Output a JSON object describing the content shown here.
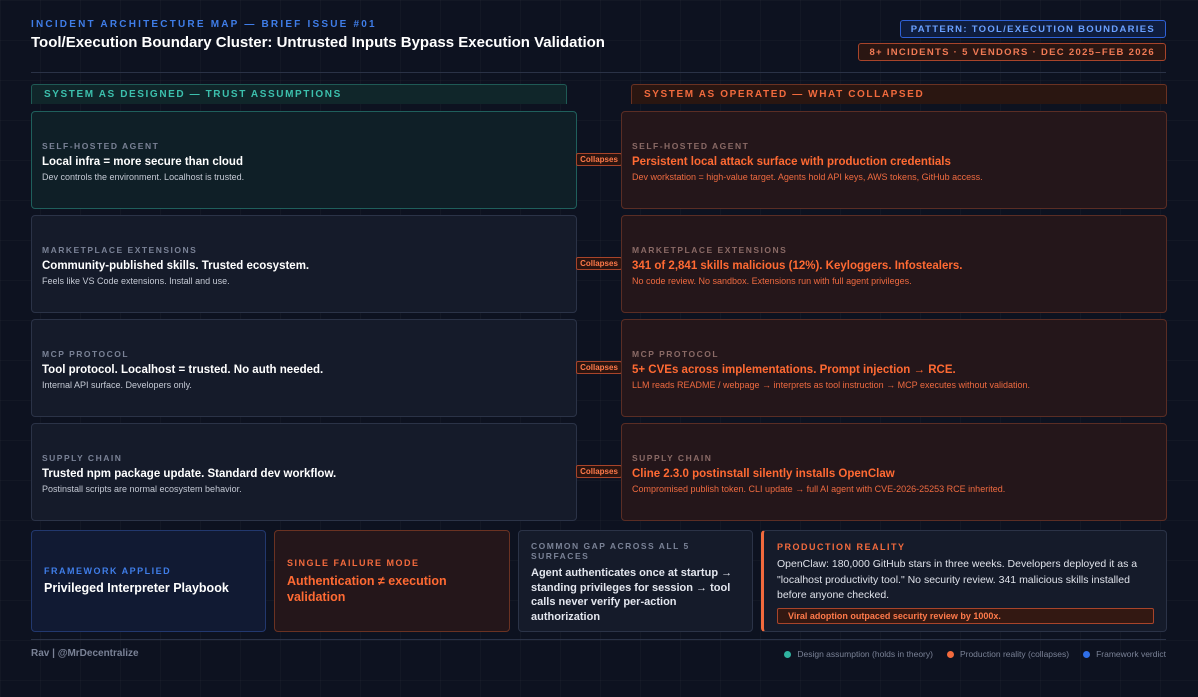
{
  "header": {
    "kicker": "INCIDENT ARCHITECTURE MAP — BRIEF ISSUE #01",
    "title": "Tool/Execution Boundary Cluster: Untrusted Inputs Bypass Execution Validation",
    "pattern_tag": "PATTERN: TOOL/EXECUTION BOUNDARIES",
    "incidents_tag": "8+ INCIDENTS · 5 VENDORS · DEC 2025–FEB 2026"
  },
  "columns": {
    "designed": "SYSTEM AS DESIGNED — TRUST ASSUMPTIONS",
    "operated": "SYSTEM AS OPERATED — WHAT COLLAPSED"
  },
  "collapse_label": "Collapses",
  "rows": [
    {
      "label": "SELF-HOSTED AGENT",
      "designed_main": "Local infra = more secure than cloud",
      "designed_sub": "Dev controls the environment. Localhost is trusted.",
      "operated_main": "Persistent local attack surface with production credentials",
      "operated_sub": "Dev workstation = high-value target. Agents hold API keys, AWS tokens, GitHub access."
    },
    {
      "label": "MARKETPLACE EXTENSIONS",
      "designed_main": "Community-published skills. Trusted ecosystem.",
      "designed_sub": "Feels like VS Code extensions. Install and use.",
      "operated_main": "341 of 2,841 skills malicious (12%). Keyloggers. Infostealers.",
      "operated_sub": "No code review. No sandbox. Extensions run with full agent privileges."
    },
    {
      "label": "MCP PROTOCOL",
      "designed_main": "Tool protocol. Localhost = trusted. No auth needed.",
      "designed_sub": "Internal API surface. Developers only.",
      "operated_main": "5+ CVEs across implementations. Prompt injection → RCE.",
      "operated_sub": "LLM reads README / webpage → interprets as tool instruction → MCP executes without validation."
    },
    {
      "label": "SUPPLY CHAIN",
      "designed_main": "Trusted npm package update. Standard dev workflow.",
      "designed_sub": "Postinstall scripts are normal ecosystem behavior.",
      "operated_main": "Cline 2.3.0 postinstall silently installs OpenClaw",
      "operated_sub": "Compromised publish token. CLI update → full AI agent with CVE-2026-25253 RCE inherited."
    }
  ],
  "bottom": {
    "framework": {
      "label": "FRAMEWORK APPLIED",
      "main": "Privileged Interpreter Playbook"
    },
    "failure": {
      "label": "SINGLE FAILURE MODE",
      "main": "Authentication ≠ execution validation"
    },
    "gap": {
      "label": "COMMON GAP ACROSS ALL 5 SURFACES",
      "main": "Agent authenticates once at startup → standing privileges for session → tool calls never verify per-action authorization"
    },
    "reality": {
      "label": "PRODUCTION REALITY",
      "main": "OpenClaw: 180,000 GitHub stars in three weeks. Developers deployed it as a \"localhost productivity tool.\" No security review. 341 malicious skills installed before anyone checked.",
      "highlight": "Viral adoption outpaced security review by 1000x."
    }
  },
  "footer": {
    "author": "Rav | @MrDecentralize",
    "legend": [
      {
        "label": "Design assumption (holds in theory)",
        "color": "#2fb3a0"
      },
      {
        "label": "Production reality (collapses)",
        "color": "#f26a3d"
      },
      {
        "label": "Framework verdict",
        "color": "#2f6fe8"
      }
    ]
  }
}
